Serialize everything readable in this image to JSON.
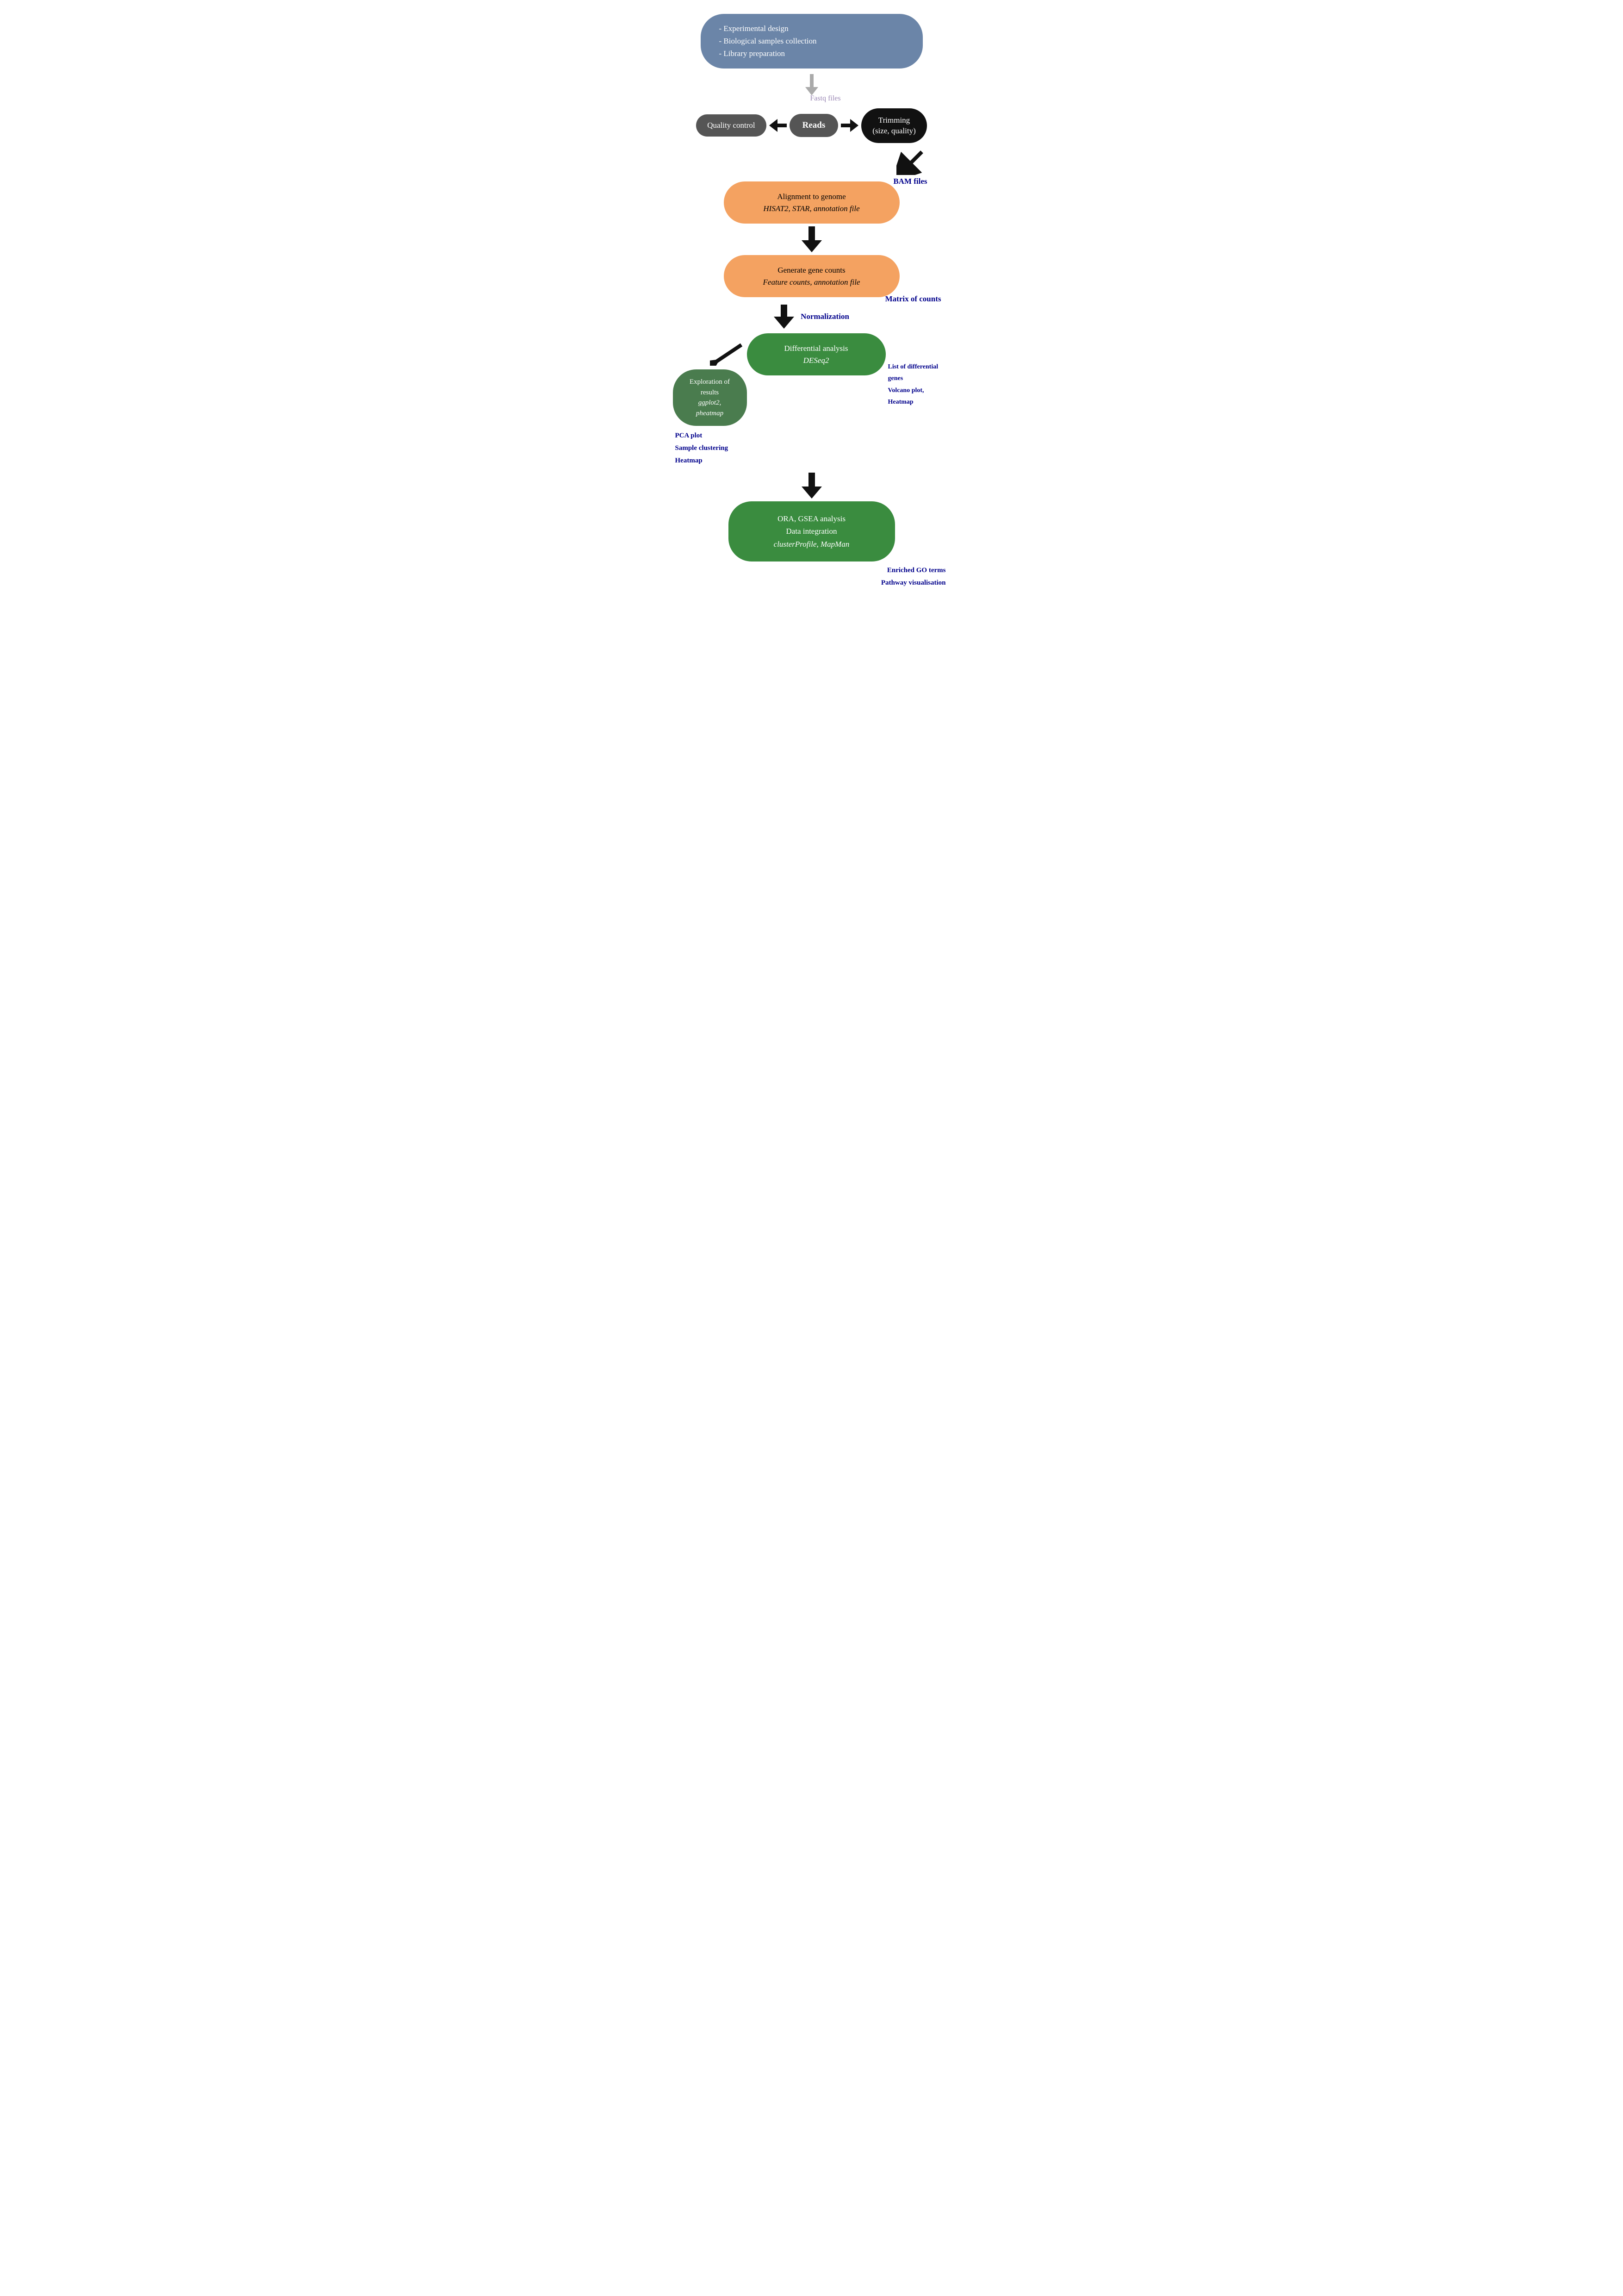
{
  "top_pill": {
    "line1": "- Experimental design",
    "line2": "- Biological samples collection",
    "line3": "- Library preparation"
  },
  "fastq_label": "Fastq files",
  "reads_row": {
    "qc_label": "Quality control",
    "reads_label": "Reads",
    "trimming_label_line1": "Trimming",
    "trimming_label_line2": "(size, quality)"
  },
  "bam_label": "BAM files",
  "alignment_pill": {
    "line1": "Alignment to genome",
    "line2": "HISAT2, STAR, annotation file"
  },
  "gene_counts_pill": {
    "line1": "Generate gene counts",
    "line2": "Feature counts, annotation file"
  },
  "matrix_label": "Matrix of counts",
  "normalization_label": "Normalization",
  "exploration_pill": {
    "line1": "Exploration of results",
    "line2": "ggplot2, pheatmap"
  },
  "pca_labels": {
    "line1": "PCA plot",
    "line2": "Sample clustering",
    "line3": "Heatmap"
  },
  "differential_pill": {
    "line1": "Differential analysis",
    "line2": "DESeq2"
  },
  "diff_labels": {
    "line1": "List of differential genes",
    "line2": "Volcano plot,",
    "line3": "Heatmap"
  },
  "enriched_pill": {
    "line1": "ORA, GSEA analysis",
    "line2": "Data integration",
    "line3": "clusterProfile, MapMan"
  },
  "enriched_labels": {
    "line1": "Enriched GO terms",
    "line2": "Pathway visualisation"
  }
}
